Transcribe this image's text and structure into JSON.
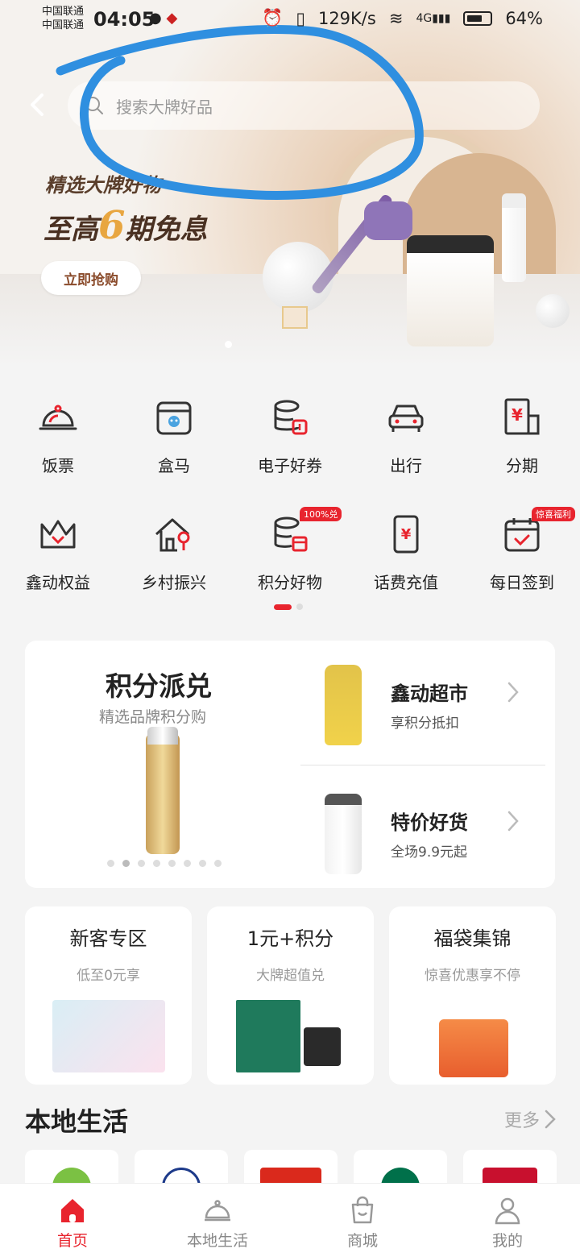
{
  "status_bar": {
    "carrier_1": "中国联通",
    "carrier_2": "中国联通",
    "time": "04:05",
    "net_speed": "129K/s",
    "battery": "64%"
  },
  "banner": {
    "promo_line1": "精选大牌好物",
    "promo_line2_prefix": "至高",
    "promo_line2_number": "6",
    "promo_line2_suffix": "期免息",
    "button": "立即抢购"
  },
  "search": {
    "placeholder": "搜索大牌好品"
  },
  "services": [
    {
      "label": "饭票",
      "icon": "dining-cloche-icon"
    },
    {
      "label": "盒马",
      "icon": "hema-store-icon"
    },
    {
      "label": "电子好券",
      "icon": "coupon-icon"
    },
    {
      "label": "出行",
      "icon": "car-icon"
    },
    {
      "label": "分期",
      "icon": "installment-icon"
    },
    {
      "label": "鑫动权益",
      "icon": "crown-icon"
    },
    {
      "label": "乡村振兴",
      "icon": "village-house-icon"
    },
    {
      "label": "积分好物",
      "icon": "points-gift-icon",
      "tag": "100%兑"
    },
    {
      "label": "话费充值",
      "icon": "phone-topup-icon"
    },
    {
      "label": "每日签到",
      "icon": "calendar-check-icon",
      "tag": "惊喜福利"
    }
  ],
  "points_card": {
    "title": "积分派兑",
    "subtitle": "精选品牌积分购",
    "items": [
      {
        "name": "鑫动超市",
        "desc": "享积分抵扣"
      },
      {
        "name": "特价好货",
        "desc": "全场9.9元起"
      }
    ]
  },
  "promo_cards": [
    {
      "title": "新客专区",
      "sub": "低至0元享"
    },
    {
      "title": "1元+积分",
      "sub": "大牌超值兑"
    },
    {
      "title": "福袋集锦",
      "sub": "惊喜优惠享不停"
    }
  ],
  "local_life": {
    "title": "本地生活",
    "more": "更多"
  },
  "bottom_nav": [
    {
      "label": "首页",
      "icon": "home-icon",
      "active": true
    },
    {
      "label": "本地生活",
      "icon": "cloche-icon",
      "active": false
    },
    {
      "label": "商城",
      "icon": "shopping-bag-icon",
      "active": false
    },
    {
      "label": "我的",
      "icon": "user-icon",
      "active": false
    }
  ],
  "colors": {
    "accent": "#e8242e",
    "scribble": "#2f8fe0"
  }
}
